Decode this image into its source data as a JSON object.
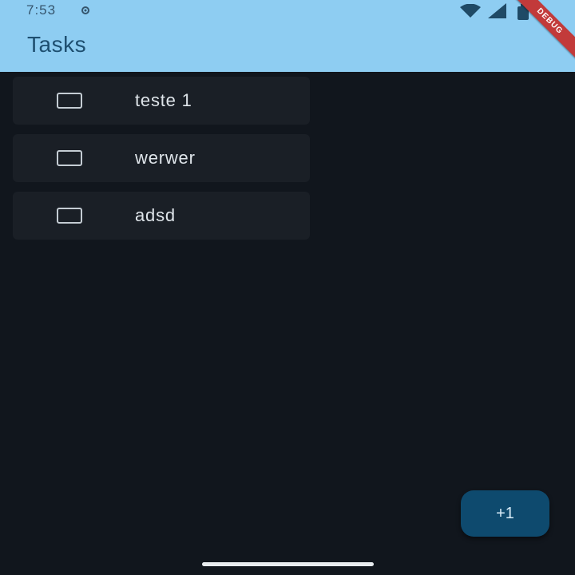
{
  "status_bar": {
    "time": "7:53"
  },
  "debug_banner": {
    "label": "DEBUG"
  },
  "app_bar": {
    "title": "Tasks"
  },
  "tasks": [
    {
      "label": "teste 1",
      "checked": false
    },
    {
      "label": "werwer",
      "checked": false
    },
    {
      "label": "adsd",
      "checked": false
    }
  ],
  "fab": {
    "label": "+1"
  },
  "colors": {
    "app_bar": "#8ecdf2",
    "background": "#11161d",
    "task_card": "#1a1f26",
    "fab": "#0e4a6e",
    "debug_banner": "#c23a3a"
  }
}
